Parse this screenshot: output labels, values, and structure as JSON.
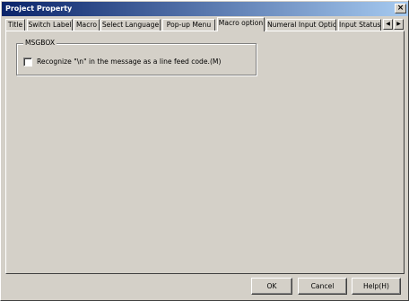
{
  "window": {
    "title": "Project Property",
    "close_glyph": "×"
  },
  "tabs": [
    {
      "label": "Title"
    },
    {
      "label": "Switch Label"
    },
    {
      "label": "Macro"
    },
    {
      "label": "Select Language"
    },
    {
      "label": "Pop-up Menu"
    },
    {
      "label": "Macro option",
      "active": true
    },
    {
      "label": "Numeral Input Options"
    },
    {
      "label": "Input Status I"
    }
  ],
  "tab_scroll": {
    "left_glyph": "◀",
    "right_glyph": "▶"
  },
  "group": {
    "label": "MSGBOX",
    "checkbox_label": "Recognize \"\\n\" in the message as a line feed code.(M)",
    "checkbox_checked": false
  },
  "buttons": {
    "ok": "OK",
    "cancel": "Cancel",
    "help": "Help(H)"
  },
  "icons": {
    "close": "close-icon",
    "tab_left": "arrow-left-icon",
    "tab_right": "arrow-right-icon"
  }
}
